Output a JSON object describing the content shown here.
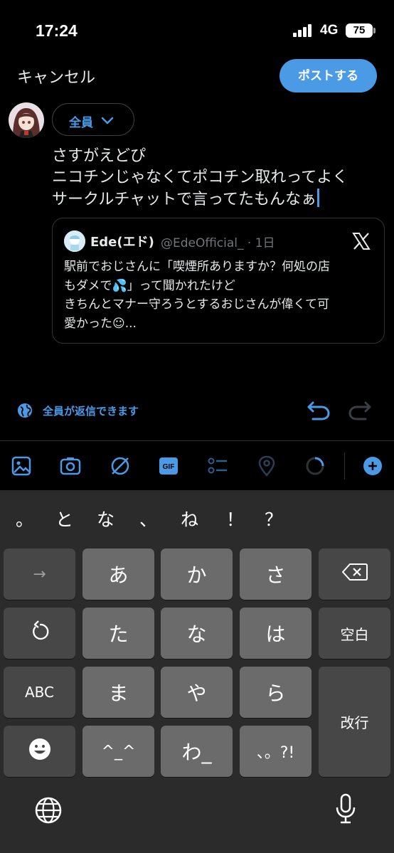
{
  "status_bar": {
    "time": "17:24",
    "network": "4G",
    "battery": "75"
  },
  "header": {
    "cancel_label": "キャンセル",
    "post_label": "ポストする"
  },
  "composer": {
    "audience_label": "全員",
    "text_lines": [
      "さすがえどぴ",
      "ニコチンじゃなくてポコチン取れってよく",
      "サークルチャットで言ってたもんなぁ"
    ]
  },
  "quote": {
    "name": "Ede(エド)",
    "handle_time": "@EdeOfficial_ · 1日",
    "body_lines": [
      "駅前でおじさんに「喫煙所ありますか？何処の店",
      "もダメで💦」って聞かれたけど",
      "きちんとマナー守ろうとするおじさんが偉くて可",
      "愛かった☺..."
    ]
  },
  "reply_setting": {
    "label": "全員が返信できます"
  },
  "toolbar": {
    "icons": [
      "image-icon",
      "camera-icon",
      "no-sign-icon",
      "gif-icon",
      "poll-icon",
      "location-icon",
      "progress-ring-icon",
      "add-icon"
    ],
    "gif_label": "GIF"
  },
  "keyboard": {
    "candidates": [
      "。",
      "と",
      "な",
      "、",
      "ね",
      "！",
      "？"
    ],
    "rows": [
      [
        "→",
        "あ",
        "か",
        "さ",
        "delete"
      ],
      [
        "undo",
        "た",
        "な",
        "は",
        "空白"
      ],
      [
        "ABC",
        "ま",
        "や",
        "ら",
        "改行"
      ],
      [
        "emoji",
        "^^",
        "わ_",
        "、。?!"
      ]
    ],
    "labels": {
      "arrow": "→",
      "a": "あ",
      "ka": "か",
      "sa": "さ",
      "ta": "た",
      "na": "な",
      "ha": "は",
      "space": "空白",
      "abc": "ABC",
      "ma": "ま",
      "ya": "や",
      "ra": "ら",
      "return": "改行",
      "kaomoji": "^_^",
      "wa": "わ_",
      "punct": "、。?!"
    }
  },
  "colors": {
    "accent": "#4a9ae5",
    "background": "#000000",
    "keyboard_bg": "#2b2b2b",
    "key_light": "#6b6b6b",
    "key_dark": "#474747"
  }
}
